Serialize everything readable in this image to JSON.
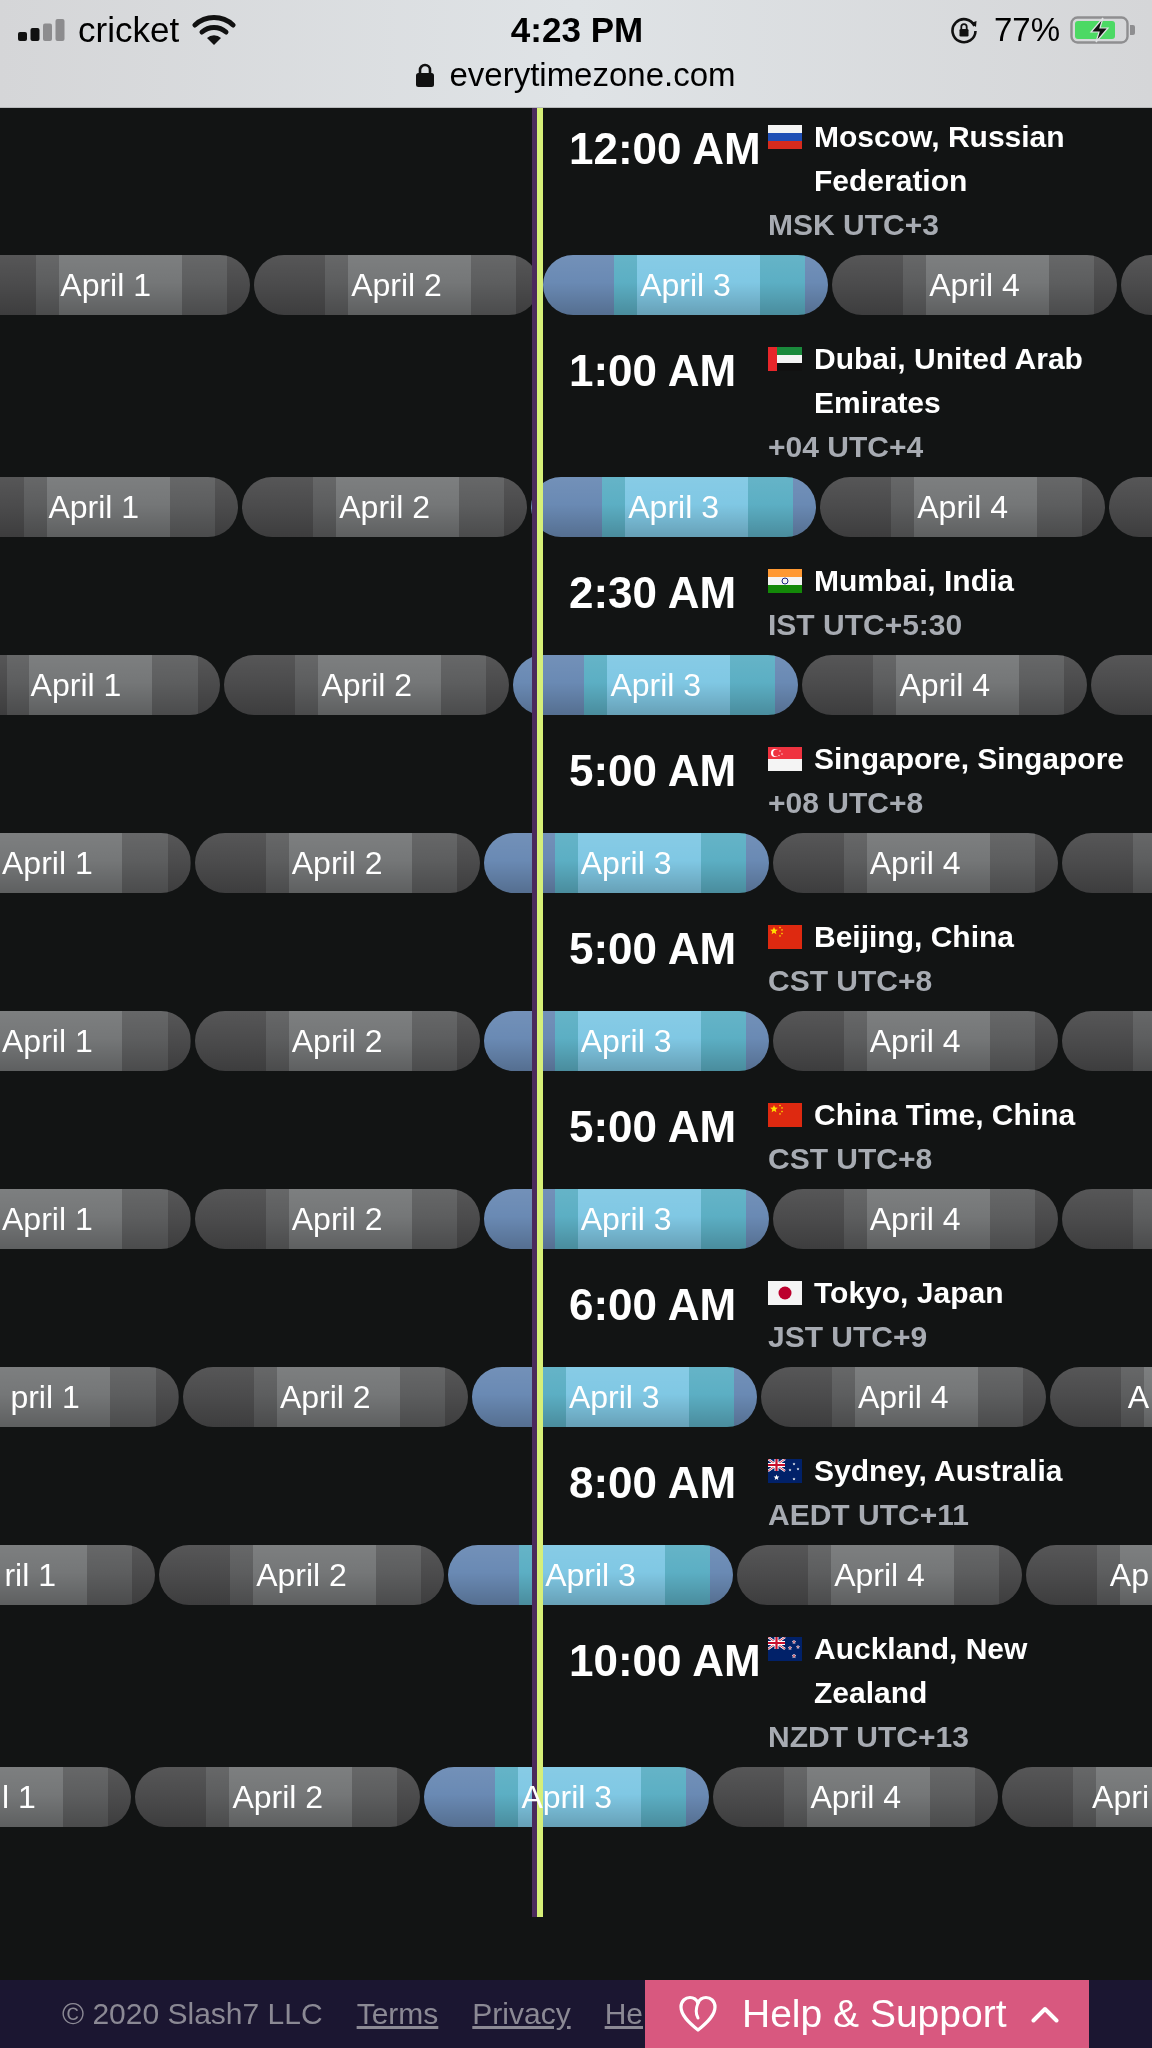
{
  "status_bar": {
    "carrier": "cricket",
    "time": "4:23 PM",
    "battery": "77%",
    "url": "everytimezone.com"
  },
  "timezones": [
    {
      "time": "12:00 AM",
      "kind": "russia",
      "city": "Moscow, Russian Federation",
      "zone": "MSK UTC+3",
      "days": [
        {
          "label": "April 1",
          "selected": false
        },
        {
          "label": "April 2",
          "selected": false
        },
        {
          "label": "April 3",
          "selected": true
        },
        {
          "label": "April 4",
          "selected": false
        },
        {
          "selected": false
        }
      ]
    },
    {
      "time": "1:00 AM",
      "kind": "uae",
      "city": "Dubai, United Arab Emirates",
      "zone": "+04 UTC+4",
      "days": [
        {
          "label": "April 1",
          "selected": false
        },
        {
          "label": "April 2",
          "selected": false
        },
        {
          "label": "April 3",
          "selected": true
        },
        {
          "label": "April 4",
          "selected": false
        },
        {
          "selected": false
        }
      ]
    },
    {
      "time": "2:30 AM",
      "kind": "india",
      "city": "Mumbai, India",
      "zone": "IST UTC+5:30",
      "days": [
        {
          "label": "April 1",
          "selected": false
        },
        {
          "label": "April 2",
          "selected": false
        },
        {
          "label": "April 3",
          "selected": true
        },
        {
          "label": "April 4",
          "selected": false
        },
        {
          "selected": false
        }
      ]
    },
    {
      "time": "5:00 AM",
      "kind": "singapore",
      "city": "Singapore, Singapore",
      "zone": "+08 UTC+8",
      "days": [
        {
          "label": "April 1",
          "selected": false
        },
        {
          "label": "April 2",
          "selected": false
        },
        {
          "label": "April 3",
          "selected": true
        },
        {
          "label": "April 4",
          "selected": false
        },
        {
          "selected": false
        }
      ]
    },
    {
      "time": "5:00 AM",
      "kind": "china",
      "city": "Beijing, China",
      "zone": "CST UTC+8",
      "days": [
        {
          "label": "April 1",
          "selected": false
        },
        {
          "label": "April 2",
          "selected": false
        },
        {
          "label": "April 3",
          "selected": true
        },
        {
          "label": "April 4",
          "selected": false
        },
        {
          "selected": false
        }
      ]
    },
    {
      "time": "5:00 AM",
      "kind": "china",
      "city": "China Time, China",
      "zone": "CST UTC+8",
      "days": [
        {
          "label": "April 1",
          "selected": false
        },
        {
          "label": "April 2",
          "selected": false
        },
        {
          "label": "April 3",
          "selected": true
        },
        {
          "label": "April 4",
          "selected": false
        },
        {
          "selected": false
        }
      ]
    },
    {
      "time": "6:00 AM",
      "kind": "japan",
      "city": "Tokyo, Japan",
      "zone": "JST UTC+9",
      "days": [
        {
          "label": "pril 1",
          "selected": false
        },
        {
          "label": "April 2",
          "selected": false
        },
        {
          "label": "April 3",
          "selected": true
        },
        {
          "label": "April 4",
          "selected": false
        },
        {
          "label": "A",
          "selected": false
        }
      ]
    },
    {
      "time": "8:00 AM",
      "kind": "australia",
      "city": "Sydney, Australia",
      "zone": "AEDT UTC+11",
      "days": [
        {
          "label": "ril 1",
          "selected": false
        },
        {
          "label": "April 2",
          "selected": false
        },
        {
          "label": "April 3",
          "selected": true
        },
        {
          "label": "April 4",
          "selected": false
        },
        {
          "label": "Ap",
          "selected": false
        }
      ]
    },
    {
      "time": "10:00 AM",
      "kind": "newzealand",
      "city": "Auckland, New Zealand",
      "zone": "NZDT UTC+13",
      "days": [
        {
          "label": "l 1",
          "selected": false
        },
        {
          "label": "April 2",
          "selected": false
        },
        {
          "label": "April 3",
          "selected": true
        },
        {
          "label": "April 4",
          "selected": false
        },
        {
          "label": "Apri",
          "selected": false
        }
      ]
    }
  ],
  "footer": {
    "copyright": "© 2020 Slash7 LLC",
    "links": [
      "Terms",
      "Privacy",
      "He"
    ],
    "help_button": "Help & Support"
  }
}
